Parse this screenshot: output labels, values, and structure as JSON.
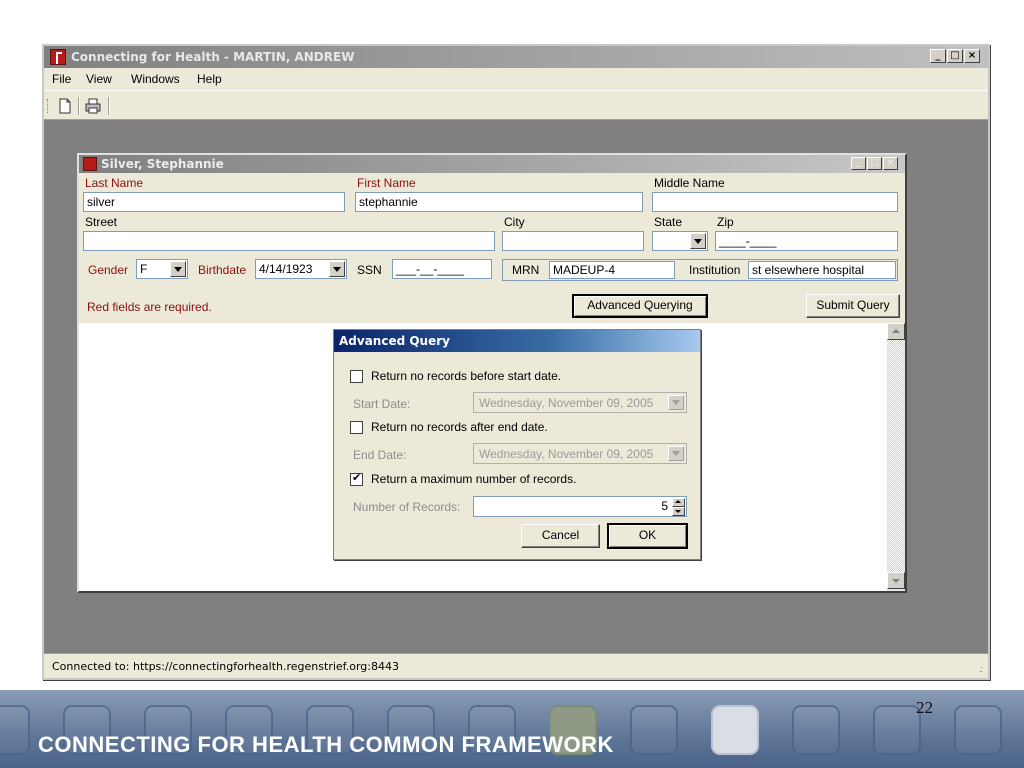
{
  "app": {
    "title": "Connecting for Health - MARTIN, ANDREW",
    "window_buttons": {
      "minimize": "_",
      "maximize": "□",
      "close": "×"
    },
    "menu": [
      "File",
      "View",
      "Windows",
      "Help"
    ],
    "toolbar": [
      "new-document-icon",
      "print-icon"
    ],
    "status": "Connected to: https://connectingforhealth.regenstrief.org:8443",
    "status_grip": ".:"
  },
  "patient_window": {
    "title": "Silver, Stephannie",
    "labels": {
      "last_name": "Last Name",
      "first_name": "First Name",
      "middle_name": "Middle Name",
      "street": "Street",
      "city": "City",
      "state": "State",
      "zip": "Zip",
      "gender": "Gender",
      "birthdate": "Birthdate",
      "ssn": "SSN",
      "mrn": "MRN",
      "institution": "Institution"
    },
    "values": {
      "last_name": "silver",
      "first_name": "stephannie",
      "middle_name": "",
      "street": "",
      "city": "",
      "state": "",
      "zip": "____-____",
      "gender": "F",
      "birthdate": "4/14/1923",
      "ssn": "___-__-____",
      "mrn": "MADEUP-4",
      "institution": "st elsewhere hospital"
    },
    "required_note": "Red fields are required.",
    "advanced_button": "Advanced Querying",
    "submit_button": "Submit Query"
  },
  "advanced_query": {
    "title": "Advanced Query",
    "start_check_label": "Return no records before start date.",
    "start_checked": false,
    "start_date_label": "Start Date:",
    "start_date_value": "Wednesday, November 09, 2005",
    "end_check_label": "Return no records after end date.",
    "end_checked": false,
    "end_date_label": "End Date:",
    "end_date_value": "Wednesday, November 09, 2005",
    "max_check_label": "Return a maximum number of records.",
    "max_checked": true,
    "records_label": "Number of Records:",
    "records_value": "5",
    "cancel_button": "Cancel",
    "ok_button": "OK"
  },
  "slide": {
    "footer_title": "CONNECTING FOR HEALTH COMMON FRAMEWORK",
    "page_number": "22"
  }
}
